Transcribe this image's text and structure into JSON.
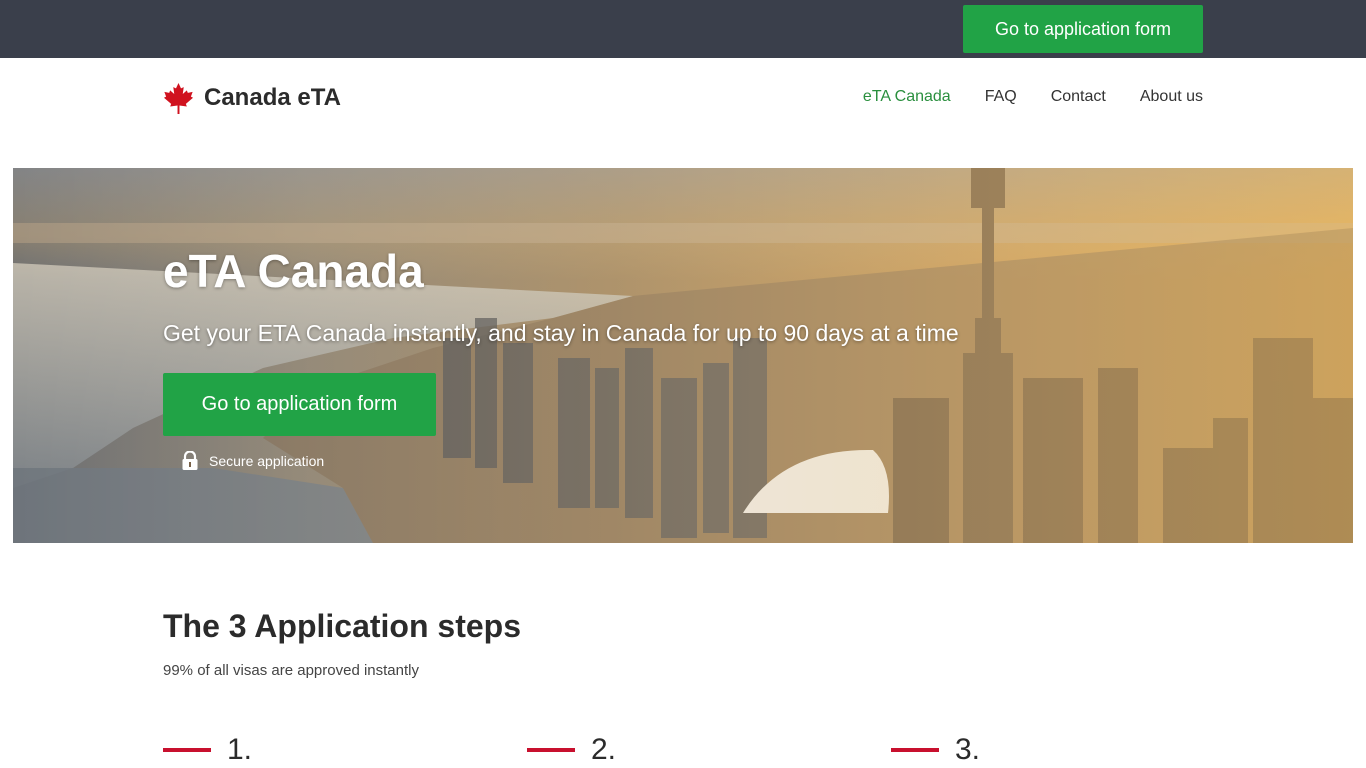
{
  "topbar": {
    "cta_label": "Go to application form"
  },
  "header": {
    "logo_text": "Canada eTA",
    "nav": [
      {
        "label": "eTA Canada",
        "active": true
      },
      {
        "label": "FAQ",
        "active": false
      },
      {
        "label": "Contact",
        "active": false
      },
      {
        "label": "About us",
        "active": false
      }
    ]
  },
  "hero": {
    "title": "eTA Canada",
    "subtitle": "Get your ETA Canada instantly, and stay in Canada for up to 90 days at a time",
    "cta_label": "Go to application form",
    "secure_label": "Secure application"
  },
  "steps": {
    "title": "The 3 Application steps",
    "subtitle": "99% of all visas are approved instantly",
    "items": [
      {
        "number": "1."
      },
      {
        "number": "2."
      },
      {
        "number": "3."
      }
    ]
  },
  "colors": {
    "topbar_bg": "#3a3f4b",
    "primary_button": "#21a346",
    "nav_active": "#2a8f3e",
    "accent_red": "#c8102e"
  },
  "icons": {
    "logo": "maple-leaf-icon",
    "secure": "lock-icon"
  }
}
